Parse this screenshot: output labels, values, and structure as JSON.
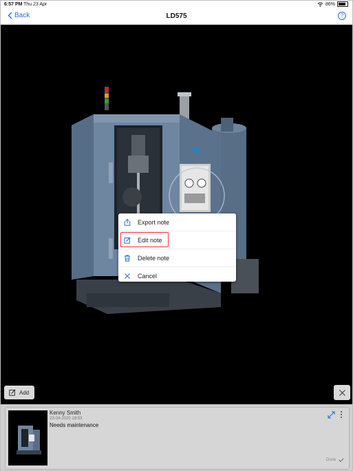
{
  "statusbar": {
    "time": "6:57 PM",
    "date": "Thu 23 Apr",
    "battery": "86%"
  },
  "navbar": {
    "back_label": "Back",
    "title": "LD575"
  },
  "context_menu": {
    "items": [
      {
        "label": "Export note",
        "icon": "export-icon"
      },
      {
        "label": "Edit note",
        "icon": "edit-icon"
      },
      {
        "label": "Delete note",
        "icon": "trash-icon"
      },
      {
        "label": "Cancel",
        "icon": "close-icon"
      }
    ],
    "highlighted_item": "Edit note",
    "highlight_color": "#e33333"
  },
  "toolbar": {
    "add_label": "Add"
  },
  "note": {
    "author": "Kenny Smith",
    "timestamp": "23-04-2020 18:53",
    "text": "Needs maintenance",
    "done_label": "Done"
  },
  "colors": {
    "accent": "#2b6cd6",
    "machine": "#6e86a0"
  }
}
